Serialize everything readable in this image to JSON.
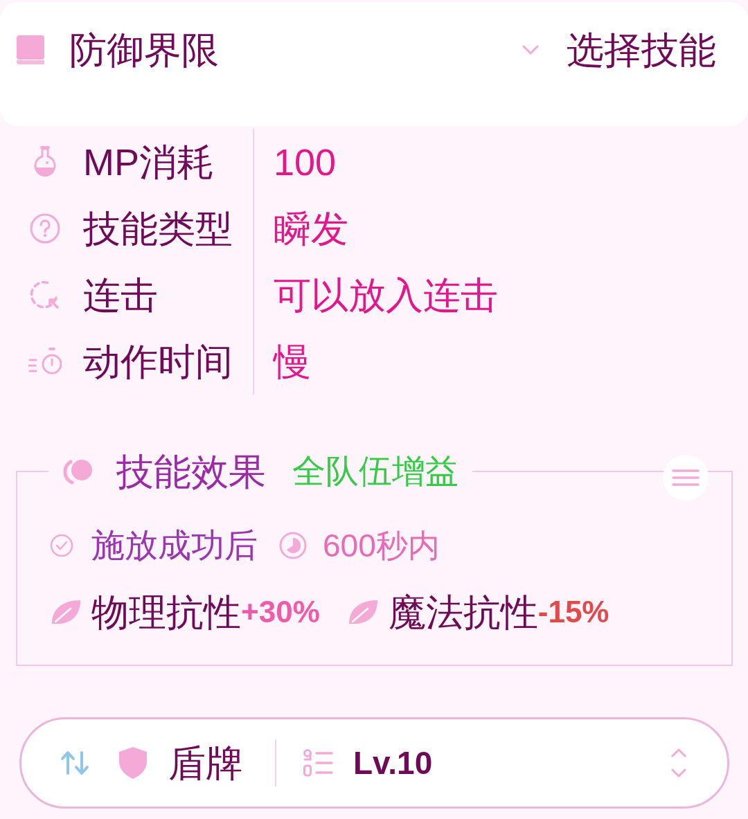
{
  "header": {
    "title": "防御界限",
    "selector_label": "选择技能"
  },
  "stats": [
    {
      "label": "MP消耗",
      "value": "100"
    },
    {
      "label": "技能类型",
      "value": "瞬发"
    },
    {
      "label": "连击",
      "value": "可以放入连击"
    },
    {
      "label": "动作时间",
      "value": "慢"
    }
  ],
  "effect": {
    "title": "技能效果",
    "scope": "全队伍增益",
    "condition": "施放成功后",
    "duration": "600秒内",
    "modifiers": [
      {
        "label": "物理抗性",
        "change": "+30%",
        "color": "#ee5ba8"
      },
      {
        "label": "魔法抗性",
        "change": "-15%",
        "color": "#e04a4a"
      }
    ]
  },
  "footer": {
    "equipment": "盾牌",
    "level": "Lv.10"
  }
}
